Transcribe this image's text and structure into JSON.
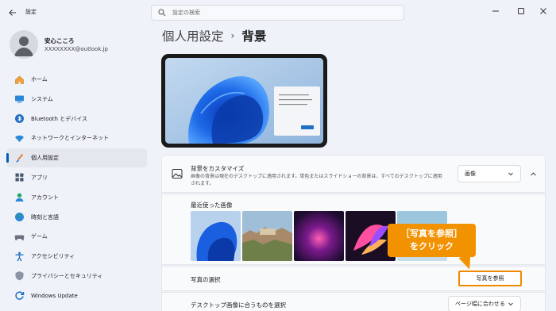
{
  "window": {
    "title": "設定",
    "search_placeholder": "設定の検索"
  },
  "profile": {
    "name": "安心こころ",
    "email": "XXXXXXXX@outlook.jp"
  },
  "sidebar": {
    "items": [
      {
        "label": "ホーム",
        "icon": "home-icon"
      },
      {
        "label": "システム",
        "icon": "system-icon"
      },
      {
        "label": "Bluetooth とデバイス",
        "icon": "bluetooth-icon"
      },
      {
        "label": "ネットワークとインターネット",
        "icon": "wifi-icon"
      },
      {
        "label": "個人用設定",
        "icon": "brush-icon",
        "active": true
      },
      {
        "label": "アプリ",
        "icon": "apps-icon"
      },
      {
        "label": "アカウント",
        "icon": "account-icon"
      },
      {
        "label": "時刻と言語",
        "icon": "globe-icon"
      },
      {
        "label": "ゲーム",
        "icon": "game-icon"
      },
      {
        "label": "アクセシビリティ",
        "icon": "accessibility-icon"
      },
      {
        "label": "プライバシーとセキュリティ",
        "icon": "shield-icon"
      },
      {
        "label": "Windows Update",
        "icon": "update-icon"
      }
    ]
  },
  "breadcrumb": {
    "parent": "個人用設定",
    "separator": "›",
    "current": "背景"
  },
  "background_section": {
    "title": "背景をカスタマイズ",
    "description": "画像の背景は現在のデスクトップに適用されます。単色またはスライドショーの背景は、すべてのデスクトップに適用されます。",
    "dropdown_value": "画像"
  },
  "recent": {
    "title": "最近使った画像"
  },
  "choose_photo": {
    "label": "写真の選択",
    "button_label": "写真を参照"
  },
  "fit": {
    "label": "デスクトップ画像に合うものを選択",
    "dropdown_value": "ページ幅に合わせる"
  },
  "callout": {
    "line1": "［写真を参照］",
    "line2": "をクリック"
  },
  "colors": {
    "accent": "#005fb8",
    "callout": "#f39200",
    "highlight_border": "#f08a00"
  }
}
